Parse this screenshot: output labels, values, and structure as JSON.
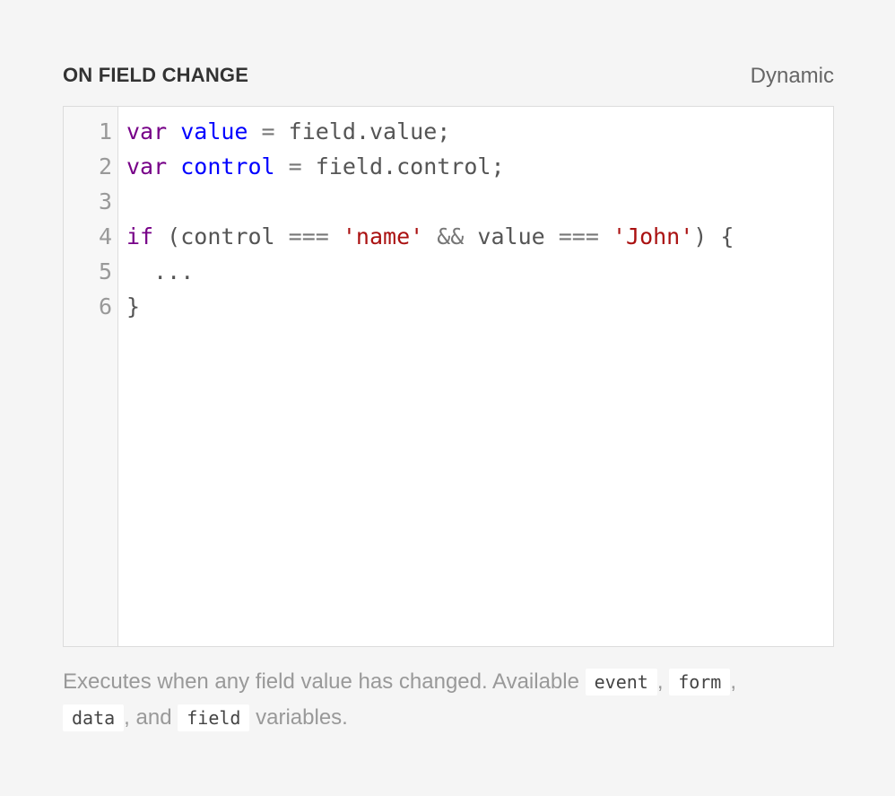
{
  "header": {
    "title": "ON FIELD CHANGE",
    "mode": "Dynamic"
  },
  "editor": {
    "lines": [
      {
        "number": "1",
        "tokens": [
          {
            "t": "kw",
            "v": "var"
          },
          {
            "t": "sp",
            "v": " "
          },
          {
            "t": "def",
            "v": "value"
          },
          {
            "t": "sp",
            "v": " "
          },
          {
            "t": "op",
            "v": "="
          },
          {
            "t": "sp",
            "v": " "
          },
          {
            "t": "var",
            "v": "field"
          },
          {
            "t": "punc",
            "v": "."
          },
          {
            "t": "var",
            "v": "value"
          },
          {
            "t": "punc",
            "v": ";"
          }
        ]
      },
      {
        "number": "2",
        "tokens": [
          {
            "t": "kw",
            "v": "var"
          },
          {
            "t": "sp",
            "v": " "
          },
          {
            "t": "def",
            "v": "control"
          },
          {
            "t": "sp",
            "v": " "
          },
          {
            "t": "op",
            "v": "="
          },
          {
            "t": "sp",
            "v": " "
          },
          {
            "t": "var",
            "v": "field"
          },
          {
            "t": "punc",
            "v": "."
          },
          {
            "t": "var",
            "v": "control"
          },
          {
            "t": "punc",
            "v": ";"
          }
        ]
      },
      {
        "number": "3",
        "tokens": []
      },
      {
        "number": "4",
        "tokens": [
          {
            "t": "kw",
            "v": "if"
          },
          {
            "t": "sp",
            "v": " "
          },
          {
            "t": "punc",
            "v": "("
          },
          {
            "t": "var",
            "v": "control"
          },
          {
            "t": "sp",
            "v": " "
          },
          {
            "t": "op",
            "v": "==="
          },
          {
            "t": "sp",
            "v": " "
          },
          {
            "t": "str",
            "v": "'name'"
          },
          {
            "t": "sp",
            "v": " "
          },
          {
            "t": "op",
            "v": "&&"
          },
          {
            "t": "sp",
            "v": " "
          },
          {
            "t": "var",
            "v": "value"
          },
          {
            "t": "sp",
            "v": " "
          },
          {
            "t": "op",
            "v": "==="
          },
          {
            "t": "sp",
            "v": " "
          },
          {
            "t": "str",
            "v": "'John'"
          },
          {
            "t": "punc",
            "v": ")"
          },
          {
            "t": "sp",
            "v": " "
          },
          {
            "t": "punc",
            "v": "{"
          }
        ]
      },
      {
        "number": "5",
        "tokens": [
          {
            "t": "sp",
            "v": "  "
          },
          {
            "t": "punc",
            "v": "..."
          }
        ]
      },
      {
        "number": "6",
        "tokens": [
          {
            "t": "punc",
            "v": "}"
          }
        ]
      }
    ]
  },
  "help": {
    "text_1": "Executes when any field value has changed. Available",
    "code_1": "event",
    "sep_1": ",",
    "code_2": "form",
    "sep_2": ",",
    "code_3": "data",
    "sep_3": ", and",
    "code_4": "field",
    "text_2": "variables."
  }
}
